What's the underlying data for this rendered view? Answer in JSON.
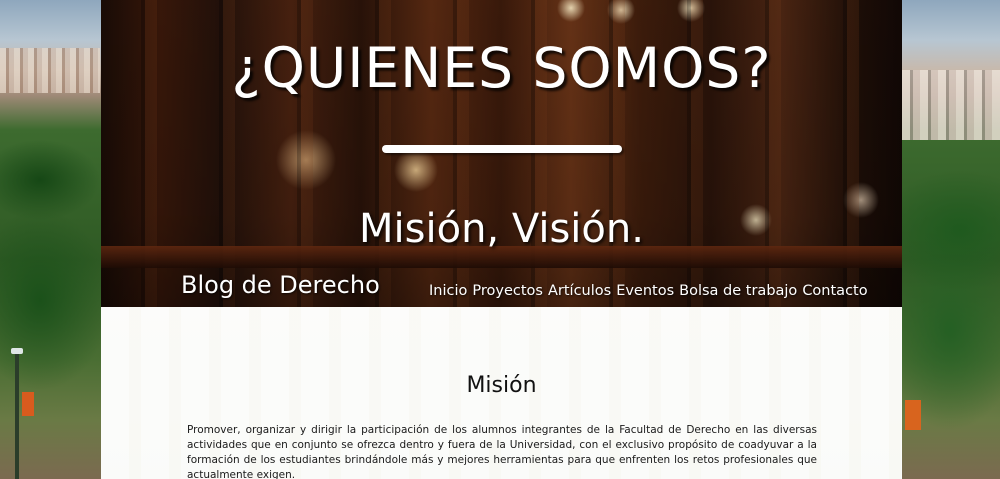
{
  "hero": {
    "title": "¿QUIENES SOMOS?",
    "subtitle": "Misión, Visión."
  },
  "header": {
    "brand": "Blog de Derecho",
    "nav": [
      {
        "label": "Inicio"
      },
      {
        "label": "Proyectos"
      },
      {
        "label": "Artículos"
      },
      {
        "label": "Eventos"
      },
      {
        "label": "Bolsa de trabajo"
      },
      {
        "label": "Contacto"
      }
    ]
  },
  "main": {
    "section_title": "Misión",
    "section_text": "Promover, organizar y dirigir la participación de los alumnos integrantes de la Facultad de Derecho en las diversas actividades que en conjunto se ofrezca dentro y fuera de la Universidad, con el exclusivo propósito de coadyuvar a la formación de los estudiantes brindándole más y mejores herramientas para que enfrenten los retos profesionales que actualmente exigen."
  },
  "colors": {
    "text_on_image": "#ffffff",
    "body_text": "#1a1a1a"
  }
}
